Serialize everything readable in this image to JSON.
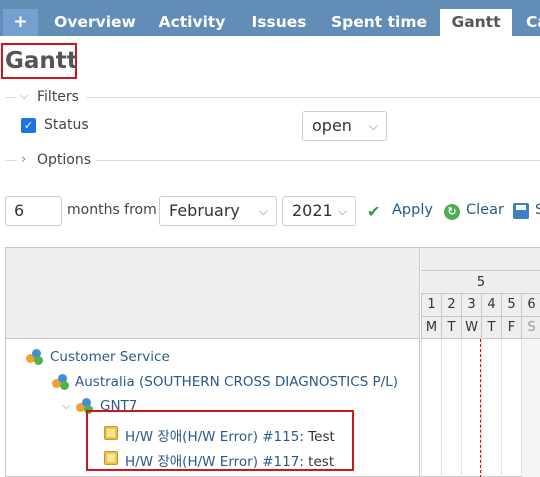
{
  "tabs": [
    {
      "label": "+",
      "selected": false
    },
    {
      "label": "Overview",
      "selected": false
    },
    {
      "label": "Activity",
      "selected": false
    },
    {
      "label": "Issues",
      "selected": false
    },
    {
      "label": "Spent time",
      "selected": false
    },
    {
      "label": "Gantt",
      "selected": true
    },
    {
      "label": "Ca",
      "selected": false
    }
  ],
  "page": {
    "title": "Gantt"
  },
  "filters": {
    "legend": "Filters",
    "status_label": "Status",
    "status_checked": true,
    "status_operator": "open"
  },
  "options": {
    "legend": "Options"
  },
  "controls": {
    "months_value": "6",
    "months_from_label": "months from",
    "month_selected": "February",
    "year_selected": "2021",
    "apply_label": "Apply",
    "clear_label": "Clear",
    "save_label": "S"
  },
  "calendar": {
    "week_number": "5",
    "days": [
      {
        "num": "1",
        "letter": "M"
      },
      {
        "num": "2",
        "letter": "T"
      },
      {
        "num": "3",
        "letter": "W"
      },
      {
        "num": "4",
        "letter": "T"
      },
      {
        "num": "5",
        "letter": "F"
      },
      {
        "num": "6",
        "letter": "S"
      }
    ]
  },
  "tree": {
    "project": "Customer Service",
    "subproject": "Australia (SOUTHERN CROSS DIAGNOSTICS P/L)",
    "subsubproject": "GNT7",
    "issues": [
      {
        "link": "H/W 장애(H/W Error) #115",
        "subject": ": Test"
      },
      {
        "link": "H/W 장애(H/W Error) #117",
        "subject": ": test"
      }
    ]
  }
}
